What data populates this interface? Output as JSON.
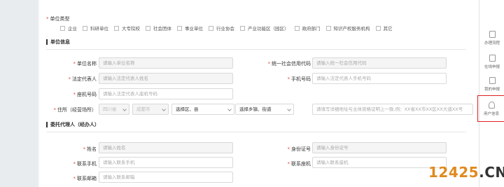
{
  "unit_type": {
    "label": "单位类型",
    "options": [
      "企业",
      "科研单位",
      "大专院校",
      "社会团体",
      "事业单位",
      "行业协会",
      "产业功能区（园区）",
      "政府部门",
      "知识产权服务机构",
      "其它"
    ]
  },
  "unit_info": {
    "section_title": "单位信息",
    "unit_name": {
      "label": "单位名称",
      "placeholder": "请输入单位名称"
    },
    "credit_code": {
      "label": "统一社会信用代码",
      "placeholder": "请输入统一社会信用代码"
    },
    "legal_rep": {
      "label": "法定代表人",
      "placeholder": "请输入法定代表人姓名"
    },
    "phone": {
      "label": "手机号码",
      "placeholder": "请输入法定代表人手机号码"
    },
    "landline": {
      "label": "座机号码",
      "placeholder": "请输入法定代表人座机号码"
    },
    "address": {
      "label": "住所（经营场所）",
      "province": "四川省",
      "city": "成都市",
      "district": "选择区、县",
      "town": "选择乡镇、街道",
      "detail_placeholder": "请填写详细地址与主体资格证明上一致,例：XX省XX市XX区XX大道XX号"
    }
  },
  "agent_info": {
    "section_title": "委托代理人（经办人）",
    "name": {
      "label": "姓名",
      "placeholder": "请输入姓名"
    },
    "id_number": {
      "label": "身份证号",
      "placeholder": "请输入身份证号"
    },
    "mobile": {
      "label": "联系手机",
      "placeholder": "请输入联系手机"
    },
    "landline": {
      "label": "联系座机",
      "placeholder": "请输入联系座机"
    },
    "email": {
      "label": "联系邮箱",
      "placeholder": "请输入联系邮箱"
    }
  },
  "sidebar": {
    "items": [
      {
        "label": "办理流程",
        "icon": "document-icon"
      },
      {
        "label": "在线申报",
        "icon": "form-icon"
      },
      {
        "label": "我的申报",
        "icon": "list-icon"
      },
      {
        "label": "用户信息",
        "icon": "user-icon"
      }
    ]
  },
  "watermark": {
    "main": "12425",
    "suffix": ".CN"
  },
  "colors": {
    "required": "#e74c3c",
    "highlight": "#e02020",
    "watermark": "#e08a1e"
  }
}
